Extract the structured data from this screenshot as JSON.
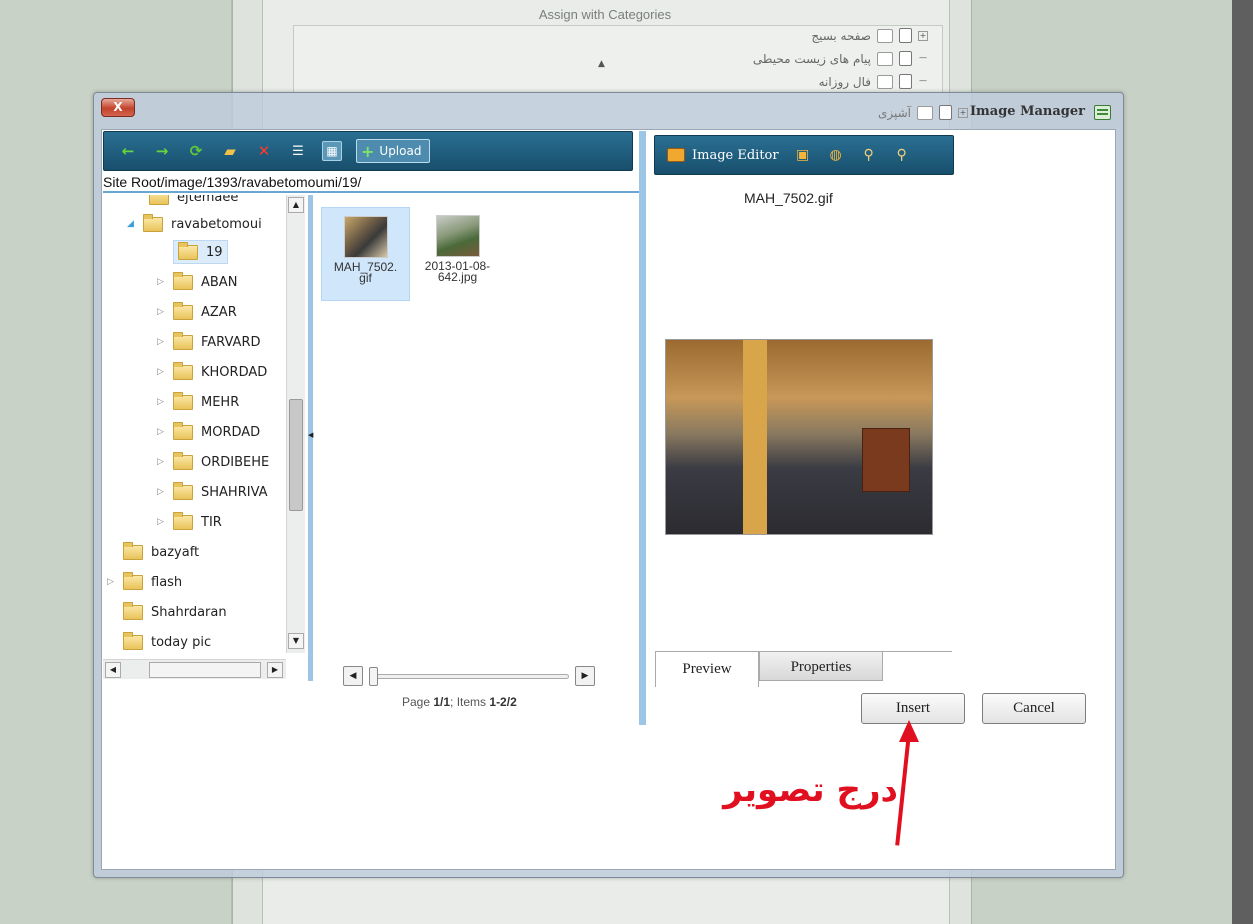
{
  "background": {
    "assign_title": "Assign with Categories",
    "categories": [
      "صفحه بسیج",
      "پیام های زیست محیطی",
      "فال روزانه",
      "آشپزی"
    ]
  },
  "dialog": {
    "title": "Image Manager",
    "close_label": "X"
  },
  "toolbar": {
    "icons": [
      "back-arrow-icon",
      "forward-arrow-icon",
      "refresh-icon",
      "new-folder-icon",
      "delete-icon",
      "list-view-icon",
      "thumbnail-view-icon"
    ],
    "upload_label": "Upload"
  },
  "path": "Site Root/image/1393/ravabetomoumi/19/",
  "tree": {
    "items": [
      {
        "label": "ejtemaee"
      },
      {
        "label": "ravabetomoui",
        "expanded": true
      },
      {
        "label": "19",
        "selected": true
      },
      {
        "label": "ABAN"
      },
      {
        "label": "AZAR"
      },
      {
        "label": "FARVARD"
      },
      {
        "label": "KHORDAD"
      },
      {
        "label": "MEHR"
      },
      {
        "label": "MORDAD"
      },
      {
        "label": "ORDIBEHE"
      },
      {
        "label": "SHAHRIVA"
      },
      {
        "label": "TIR"
      },
      {
        "label": "bazyaft"
      },
      {
        "label": "flash"
      },
      {
        "label": "Shahrdaran"
      },
      {
        "label": "today pic"
      }
    ]
  },
  "files": [
    {
      "name_line1": "MAH_7502.",
      "name_line2": "gif",
      "selected": true
    },
    {
      "name_line1": "2013-01-08-",
      "name_line2": "642.jpg",
      "selected": false
    }
  ],
  "pager": {
    "page_prefix": "Page ",
    "page_value": "1/1",
    "items_prefix": "; Items ",
    "items_value": "1-2/2"
  },
  "editor": {
    "image_editor_label": "Image Editor",
    "tool_icons": [
      "fit-icon",
      "crop-icon",
      "zoom-in-icon",
      "zoom-out-icon"
    ],
    "selected_file": "MAH_7502.gif"
  },
  "tabs": {
    "preview": "Preview",
    "properties": "Properties"
  },
  "buttons": {
    "insert": "Insert",
    "cancel": "Cancel"
  },
  "annotation": {
    "text": "درج تصویر",
    "color": "#e01020"
  }
}
